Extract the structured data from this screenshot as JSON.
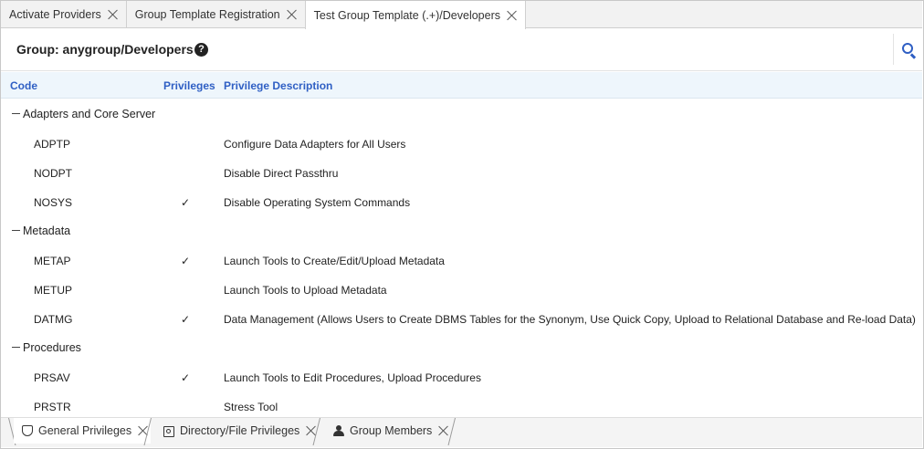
{
  "tabs": [
    {
      "label": "Activate Providers",
      "active": false
    },
    {
      "label": "Group Template Registration",
      "active": false
    },
    {
      "label": "Test Group Template (.+)/Developers",
      "active": true
    }
  ],
  "header": {
    "title": "Group: anygroup/Developers",
    "help_glyph": "?",
    "help_icon": "help-icon",
    "search_icon": "search-icon"
  },
  "columns": {
    "code": "Code",
    "privileges": "Privileges",
    "description": "Privilege Description"
  },
  "check_glyph": "✓",
  "rows": [
    {
      "type": "group",
      "label": "Adapters and Core Server"
    },
    {
      "type": "item",
      "code": "ADPTP",
      "checked": false,
      "description": "Configure Data Adapters for All Users"
    },
    {
      "type": "item",
      "code": "NODPT",
      "checked": false,
      "description": "Disable Direct Passthru"
    },
    {
      "type": "item",
      "code": "NOSYS",
      "checked": true,
      "description": "Disable Operating System Commands"
    },
    {
      "type": "group",
      "label": "Metadata"
    },
    {
      "type": "item",
      "code": "METAP",
      "checked": true,
      "description": "Launch Tools to Create/Edit/Upload Metadata"
    },
    {
      "type": "item",
      "code": "METUP",
      "checked": false,
      "description": "Launch Tools to Upload Metadata"
    },
    {
      "type": "item",
      "code": "DATMG",
      "checked": true,
      "description": "Data Management (Allows Users to Create DBMS Tables for the Synonym, Use Quick Copy, Upload to Relational Database and Re-load Data)"
    },
    {
      "type": "group",
      "label": "Procedures"
    },
    {
      "type": "item",
      "code": "PRSAV",
      "checked": true,
      "description": "Launch Tools to Edit Procedures, Upload Procedures"
    },
    {
      "type": "item",
      "code": "PRSTR",
      "checked": false,
      "description": "Stress Tool"
    }
  ],
  "bottom_tabs": [
    {
      "label": "General Privileges",
      "icon": "shield-icon",
      "active": true
    },
    {
      "label": "Directory/File Privileges",
      "icon": "folder-icon",
      "active": false
    },
    {
      "label": "Group Members",
      "icon": "person-icon",
      "active": false
    }
  ],
  "colors": {
    "accent": "#2f5fc4",
    "header_bg": "#eef6fc"
  }
}
